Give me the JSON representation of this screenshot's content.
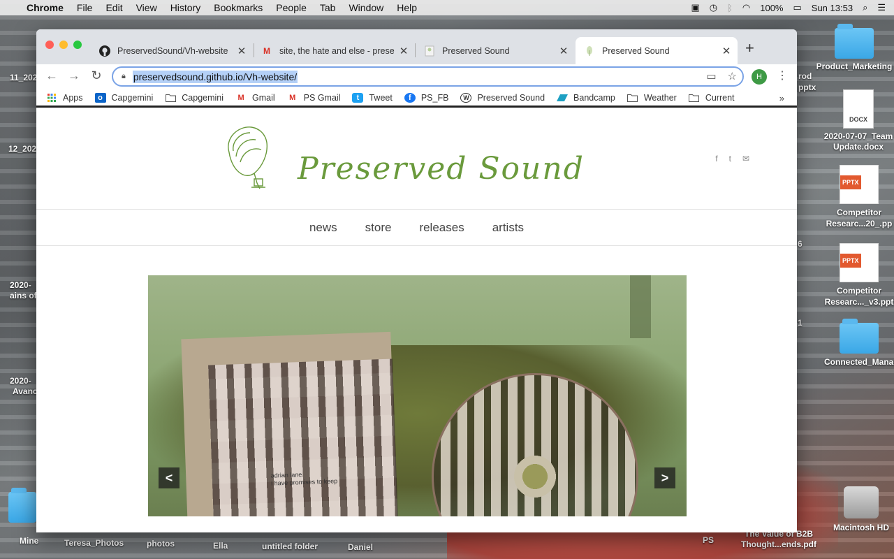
{
  "menubar": {
    "app": "Chrome",
    "items": [
      "File",
      "Edit",
      "View",
      "History",
      "Bookmarks",
      "People",
      "Tab",
      "Window",
      "Help"
    ],
    "battery": "100%",
    "clock": "Sun 13:53"
  },
  "desktop": {
    "left_labels": [
      "11_202",
      "12_202",
      "2020-",
      "ains of",
      "2020-",
      "Avanc"
    ],
    "right_items": [
      {
        "label": "Product_Marketing",
        "type": "folder"
      },
      {
        "label": "2020-07-07_Team Update.docx",
        "type": "docx",
        "badge": "DOCX"
      },
      {
        "label": "Competitor Researc...20_.pp",
        "type": "pptx",
        "badge": "PPTX"
      },
      {
        "label": "Competitor Researc..._v3.ppt",
        "type": "pptx",
        "badge": "PPTX"
      },
      {
        "label": "Connected_Manager",
        "type": "folder"
      },
      {
        "label": "The Value of B2B Thought...ends.pdf",
        "type": "pdf"
      },
      {
        "label": "Macintosh HD",
        "type": "drive"
      }
    ],
    "bottom_labels": [
      "Mine",
      "Teresa_Photos",
      "photos",
      "Ella",
      "untitled folder",
      "Daniel",
      "PS"
    ],
    "partial_labels": [
      "rod",
      "pptx",
      "6",
      "1"
    ]
  },
  "browser": {
    "tabs": [
      {
        "title": "PreservedSound/Vh-website",
        "icon": "github-icon",
        "active": false
      },
      {
        "title": "site, the hate and else - prese",
        "icon": "gmail-icon",
        "active": false
      },
      {
        "title": "Preserved Sound",
        "icon": "page-icon",
        "active": false
      },
      {
        "title": "Preserved Sound",
        "icon": "leaf-icon",
        "active": true
      }
    ],
    "url": "preservedsound.github.io/Vh-website/",
    "profile_initial": "H",
    "bookmarks": [
      {
        "label": "Apps",
        "icon": "apps-grid-icon"
      },
      {
        "label": "Capgemini",
        "icon": "outlook-icon"
      },
      {
        "label": "Capgemini",
        "icon": "folder-icon"
      },
      {
        "label": "Gmail",
        "icon": "gmail-icon"
      },
      {
        "label": "PS Gmail",
        "icon": "gmail-icon"
      },
      {
        "label": "Tweet",
        "icon": "twitter-icon"
      },
      {
        "label": "PS_FB",
        "icon": "facebook-icon"
      },
      {
        "label": "Preserved Sound",
        "icon": "wordpress-icon"
      },
      {
        "label": "Bandcamp",
        "icon": "bandcamp-icon"
      },
      {
        "label": "Weather",
        "icon": "folder-icon"
      },
      {
        "label": "Current",
        "icon": "folder-icon"
      }
    ],
    "more_bookmarks": "»"
  },
  "site": {
    "logo_text": "Preserved Sound",
    "social": [
      "f",
      "t",
      "✉"
    ],
    "nav": [
      "news",
      "store",
      "releases",
      "artists"
    ],
    "slider": {
      "caption_artist": "adrian lane",
      "caption_title": "i have promises to keep",
      "prev": "<",
      "next": ">"
    }
  },
  "colors": {
    "brand_green": "#6a9a3c",
    "omnibox_focus": "#7aa3e6",
    "selection": "#b4d0f7"
  }
}
